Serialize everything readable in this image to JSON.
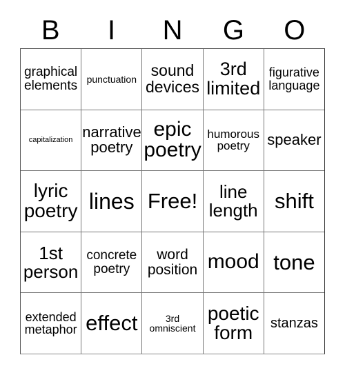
{
  "card": {
    "title": "BINGO",
    "headers": [
      "B",
      "I",
      "N",
      "G",
      "O"
    ],
    "free_space_label": "Free!",
    "colors": {
      "background": "#ffffff",
      "text": "#000000",
      "grid_line": "#777777",
      "outer_border": "#555555"
    },
    "rows": [
      [
        {
          "text": "graphical\nelements",
          "size": 19
        },
        {
          "text": "punctuation",
          "size": 14
        },
        {
          "text": "sound\ndevices",
          "size": 23
        },
        {
          "text": "3rd\nlimited",
          "size": 27
        },
        {
          "text": "figurative\nlanguage",
          "size": 18
        }
      ],
      [
        {
          "text": "capitalization",
          "size": 11
        },
        {
          "text": "narrative\npoetry",
          "size": 22
        },
        {
          "text": "epic\npoetry",
          "size": 30
        },
        {
          "text": "humorous\npoetry",
          "size": 17
        },
        {
          "text": "speaker",
          "size": 22
        }
      ],
      [
        {
          "text": "lyric\npoetry",
          "size": 28
        },
        {
          "text": "lines",
          "size": 32
        },
        {
          "text": "Free!",
          "size": 31
        },
        {
          "text": "line\nlength",
          "size": 26
        },
        {
          "text": "shift",
          "size": 31
        }
      ],
      [
        {
          "text": "1st\nperson",
          "size": 26
        },
        {
          "text": "concrete\npoetry",
          "size": 19
        },
        {
          "text": "word\nposition",
          "size": 21
        },
        {
          "text": "mood",
          "size": 30
        },
        {
          "text": "tone",
          "size": 31
        }
      ],
      [
        {
          "text": "extended\nmetaphor",
          "size": 18
        },
        {
          "text": "effect",
          "size": 31
        },
        {
          "text": "3rd\nomniscient",
          "size": 14
        },
        {
          "text": "poetic\nform",
          "size": 28
        },
        {
          "text": "stanzas",
          "size": 20
        }
      ]
    ]
  }
}
